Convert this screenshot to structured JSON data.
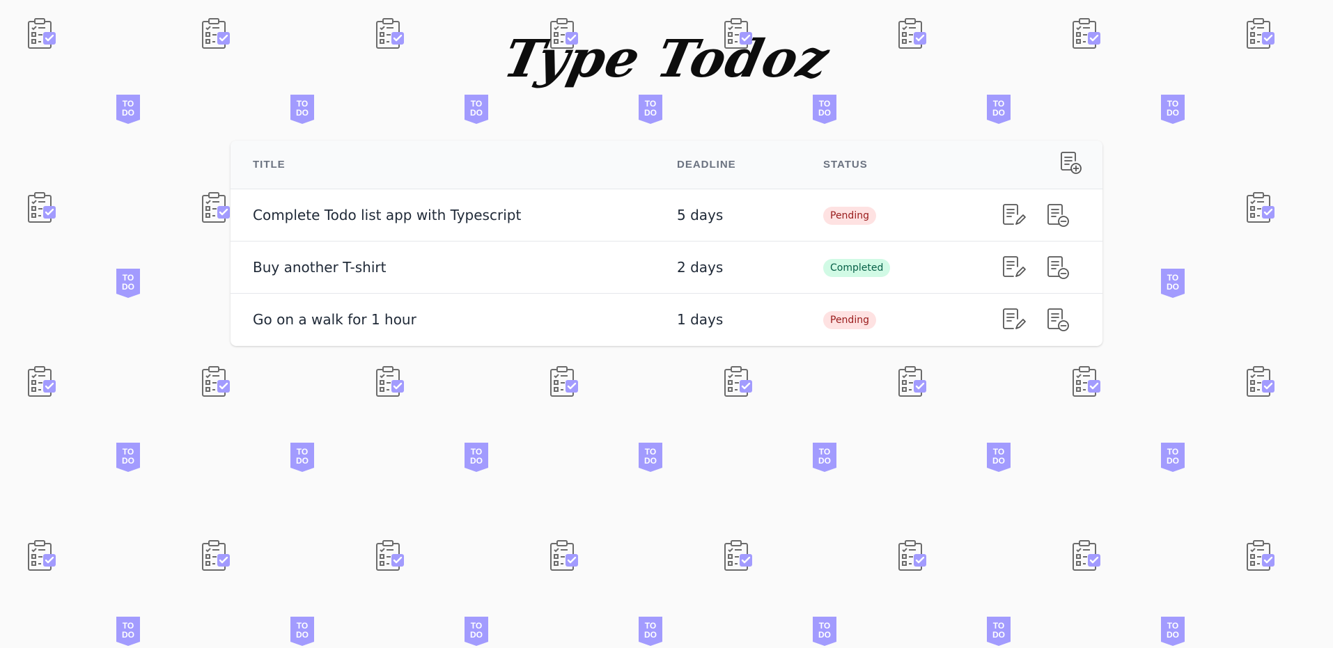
{
  "app": {
    "title": "Type Todoz"
  },
  "table": {
    "headers": {
      "title": "TITLE",
      "deadline": "DEADLINE",
      "status": "STATUS"
    },
    "add_action_icon": "add-document-icon",
    "edit_action_icon": "edit-document-icon",
    "delete_action_icon": "remove-document-icon",
    "rows": [
      {
        "title": "Complete Todo list app with Typescript",
        "deadline": "5 days",
        "status": "Pending"
      },
      {
        "title": "Buy another T-shirt",
        "deadline": "2 days",
        "status": "Completed"
      },
      {
        "title": "Go on a walk for 1 hour",
        "deadline": "1 days",
        "status": "Pending"
      }
    ]
  },
  "background": {
    "pattern_icons": [
      "clipboard-checklist-icon",
      "todo-badge-icon"
    ],
    "badge_text": "TO DO",
    "accent_color": "#a29bfe",
    "icon_stroke_color": "#6b6b6b"
  },
  "colors": {
    "pending_bg": "#fee2e2",
    "pending_text": "#991b1b",
    "completed_bg": "#d1fae5",
    "completed_text": "#065f46"
  }
}
